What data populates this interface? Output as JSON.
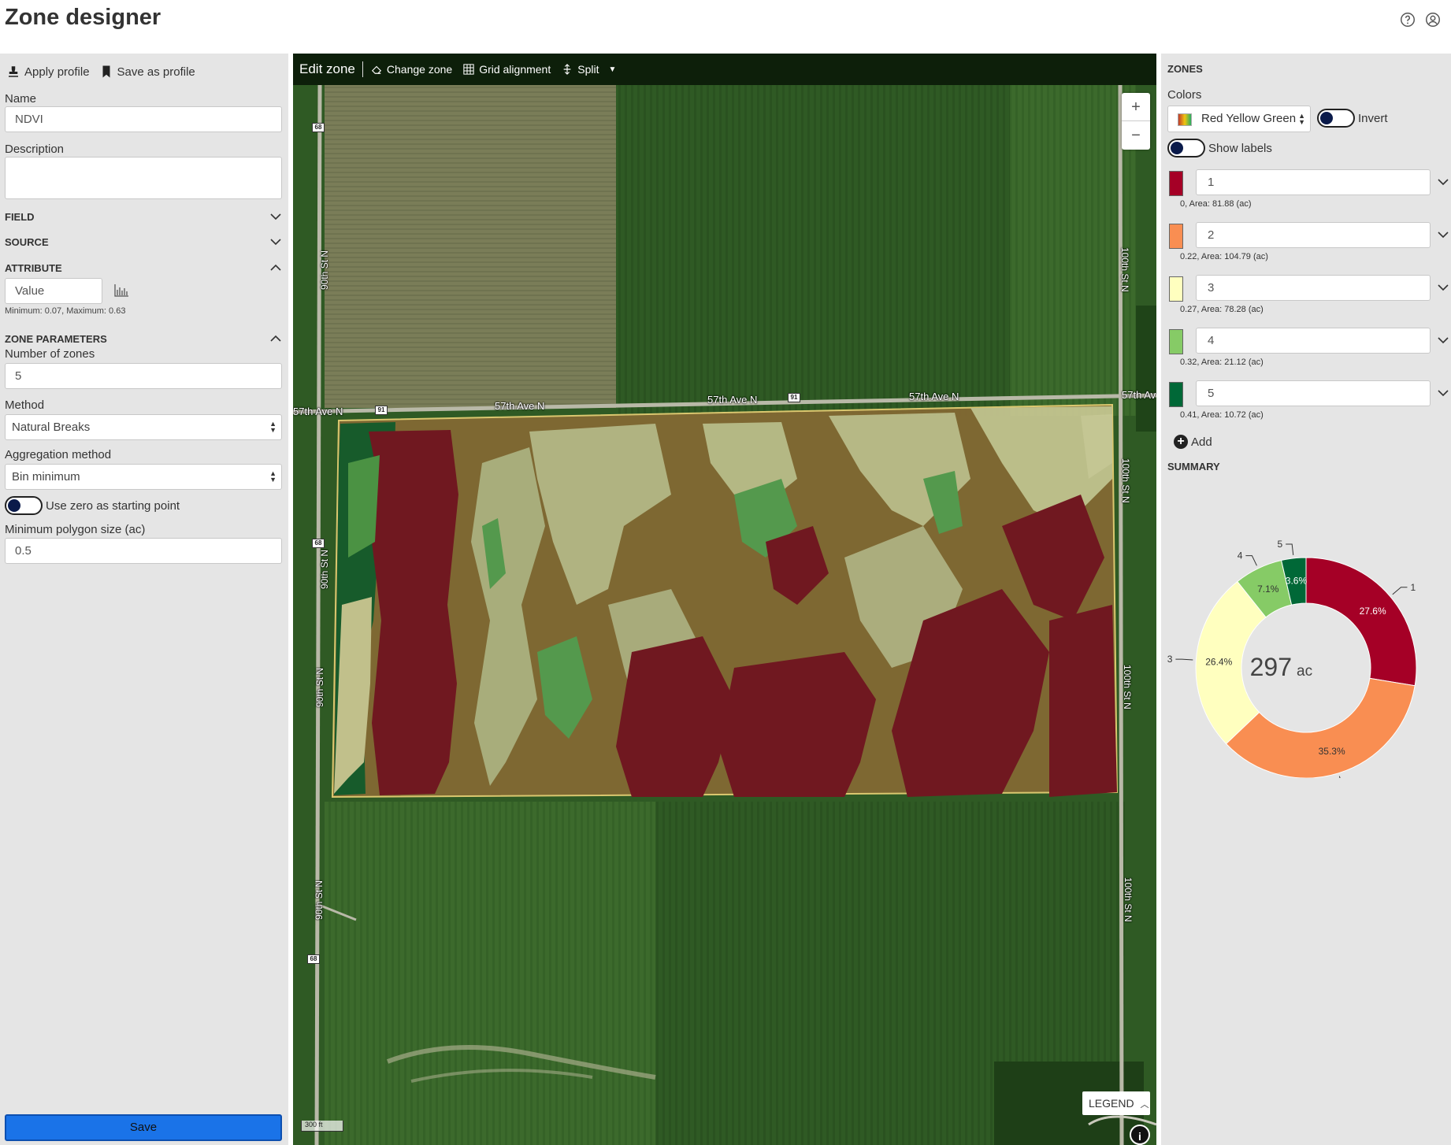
{
  "header": {
    "title": "Zone designer",
    "help_icon": "help-circle-icon",
    "account_icon": "account-circle-icon"
  },
  "left": {
    "apply_profile": "Apply profile",
    "save_profile": "Save as profile",
    "name_label": "Name",
    "name_value": "NDVI",
    "description_label": "Description",
    "description_value": "",
    "sections": {
      "field": "FIELD",
      "source": "SOURCE",
      "attribute": "ATTRIBUTE",
      "zone_params": "ZONE PARAMETERS"
    },
    "attribute_value": "Value",
    "attribute_range": "Minimum: 0.07, Maximum: 0.63",
    "num_zones_label": "Number of zones",
    "num_zones_value": "5",
    "method_label": "Method",
    "method_value": "Natural Breaks",
    "agg_label": "Aggregation method",
    "agg_value": "Bin minimum",
    "zero_start_label": "Use zero as starting point",
    "min_poly_label": "Minimum polygon size (ac)",
    "min_poly_value": "0.5",
    "save": "Save"
  },
  "map": {
    "toolbar": {
      "edit_zone": "Edit zone",
      "change_zone": "Change zone",
      "grid_alignment": "Grid alignment",
      "split": "Split"
    },
    "zoom_in": "+",
    "zoom_out": "−",
    "legend": "LEGEND",
    "info": "i",
    "scale": "300 ft",
    "roads": {
      "h1": "57th Ave N",
      "h2": "57th Ave N",
      "h3": "57th Ave N",
      "h4": "57th Ave N",
      "h5": "57th Av",
      "v_left": "90th St N",
      "v_right": "100th St N",
      "shield_68": "68",
      "shield_91": "91"
    }
  },
  "right": {
    "title": "ZONES",
    "colors_label": "Colors",
    "palette": "Red Yellow Green",
    "invert_label": "Invert",
    "show_labels": "Show labels",
    "zones": [
      {
        "name": "1",
        "color": "#a50026",
        "info": "0, Area: 81.88 (ac)"
      },
      {
        "name": "2",
        "color": "#f98e52",
        "info": "0.22, Area: 104.79 (ac)"
      },
      {
        "name": "3",
        "color": "#ffffbf",
        "info": "0.27, Area: 78.28 (ac)"
      },
      {
        "name": "4",
        "color": "#86cb66",
        "info": "0.32, Area: 21.12 (ac)"
      },
      {
        "name": "5",
        "color": "#006837",
        "info": "0.41, Area: 10.72 (ac)"
      }
    ],
    "add": "Add",
    "summary_title": "SUMMARY",
    "total_value": "297",
    "total_unit": "ac"
  },
  "chart_data": {
    "type": "pie",
    "categories": [
      "1",
      "2",
      "3",
      "4",
      "5"
    ],
    "values": [
      27.6,
      35.3,
      26.4,
      7.1,
      3.6
    ],
    "labels": [
      "27.6%",
      "35.3%",
      "26.4%",
      "7.1%",
      "3.6%"
    ],
    "colors": [
      "#a50026",
      "#f98e52",
      "#ffffbf",
      "#86cb66",
      "#006837"
    ],
    "center_label": "297 ac"
  }
}
